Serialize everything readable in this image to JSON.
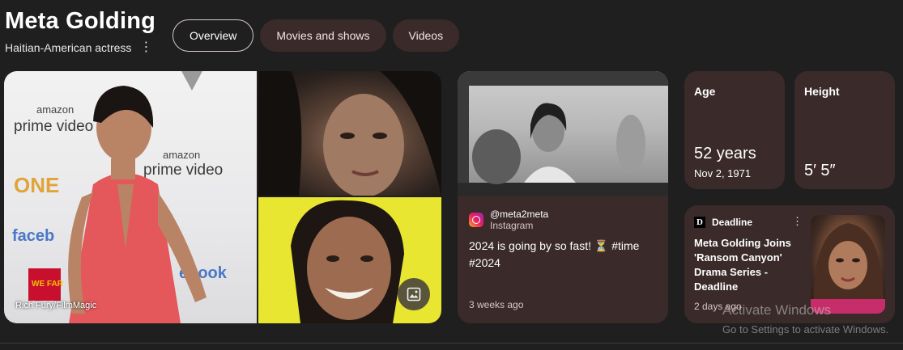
{
  "header": {
    "title": "Meta Golding",
    "subtitle": "Haitian-American actress",
    "more_icon": "vertical-dots-icon"
  },
  "tabs": [
    {
      "label": "Overview",
      "active": true
    },
    {
      "label": "Movies and shows",
      "active": false
    },
    {
      "label": "Videos",
      "active": false
    }
  ],
  "images": {
    "credit": "Rich Fury/FilmMagic",
    "gallery_icon": "image-gallery-icon",
    "main_backdrop_text": [
      "amazon",
      "prime video",
      "ONE",
      "faceb",
      "ebook",
      "WE FAR"
    ]
  },
  "instagram": {
    "handle": "@meta2meta",
    "source": "Instagram",
    "text": "2024 is going by so fast! ⏳ #time #2024",
    "time": "3 weeks ago"
  },
  "stats": {
    "age": {
      "label": "Age",
      "value": "52 years",
      "sub": "Nov 2, 1971"
    },
    "height": {
      "label": "Height",
      "value": "5′ 5″"
    }
  },
  "news": {
    "source": "Deadline",
    "logo_letter": "D",
    "title": "Meta Golding Joins 'Ransom Canyon' Drama Series - Deadline",
    "time": "2 days ago"
  },
  "watermark": {
    "line1": "Activate Windows",
    "line2": "Go to Settings to activate Windows."
  },
  "colors": {
    "background": "#1f1f1f",
    "card": "#3a2a2a",
    "accent_text": "#d9c4c4"
  }
}
